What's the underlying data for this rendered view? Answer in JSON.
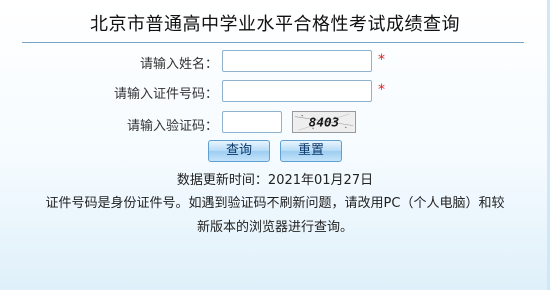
{
  "page": {
    "title": "北京市普通高中学业水平合格性考试成绩查询"
  },
  "form": {
    "name_label": "请输入姓名：",
    "name_value": "",
    "id_label": "请输入证件号码：",
    "id_value": "",
    "captcha_label": "请输入验证码：",
    "captcha_value": "",
    "required_mark": "*",
    "captcha_image_text": "8403"
  },
  "buttons": {
    "query_label": "查询",
    "reset_label": "重置"
  },
  "info": {
    "update_label": "数据更新时间：",
    "update_date": "2021年01月27日",
    "notice_line1": "证件号码是身份证件号。如遇到验证码不刷新问题，请改用PC（个人电脑）和较",
    "notice_line2": "新版本的浏览器进行查询。"
  },
  "colors": {
    "background": "#e4f3fb",
    "button_text": "#0b3a6b",
    "required": "#e02020",
    "divider": "#7aa4c5"
  }
}
